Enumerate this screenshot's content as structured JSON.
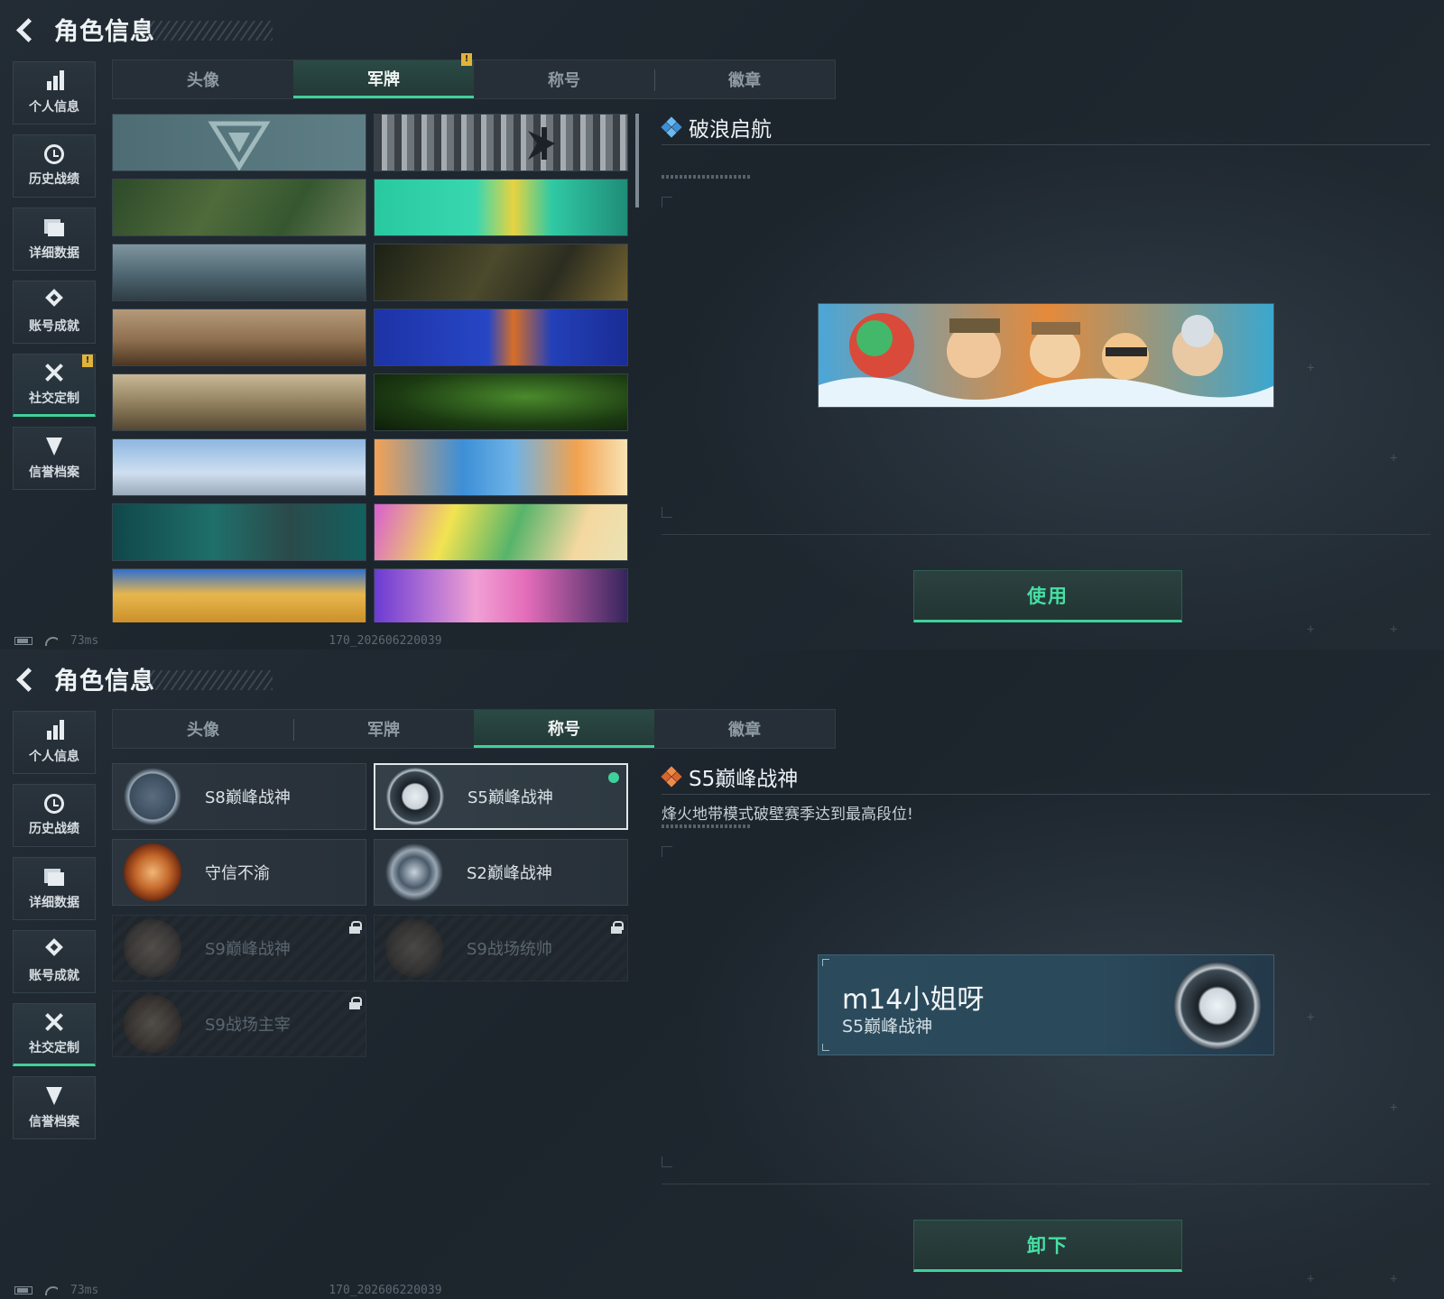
{
  "header": {
    "title": "角色信息"
  },
  "sidebar": {
    "items": [
      {
        "label": "个人信息",
        "icon": "bar-chart-icon"
      },
      {
        "label": "历史战绩",
        "icon": "clock-icon"
      },
      {
        "label": "详细数据",
        "icon": "folder-icon"
      },
      {
        "label": "账号成就",
        "icon": "medal-icon"
      },
      {
        "label": "社交定制",
        "icon": "tools-icon"
      },
      {
        "label": "信誉档案",
        "icon": "shield-icon"
      }
    ],
    "alert_mark": "!"
  },
  "tabs": [
    "头像",
    "军牌",
    "称号",
    "徽章"
  ],
  "colors": {
    "accent": "#3fd19a",
    "alert": "#e0b43a",
    "locked_text": "#5a6670"
  },
  "screen1": {
    "active_tab": "军牌",
    "tab_alert": "!",
    "selected_banner": {
      "title": "破浪启航"
    },
    "action_label": "使用",
    "banners": [
      "emblem-logo-banner",
      "chrome-logo-banner",
      "weapons-table-banner",
      "cartoon-teal-banner",
      "helicopter-sky-banner",
      "weapons-dark-banner",
      "aircraft-desert-banner",
      "blue-mask-banner",
      "sniper-ruins-banner",
      "night-vision-banner",
      "castle-sky-banner",
      "orange-fish-banner",
      "gym-teal-banner",
      "music-colorful-banner",
      "desert-sunset-banner",
      "pink-city-banner"
    ]
  },
  "screen2": {
    "active_tab": "称号",
    "selected_title": {
      "name": "S5巅峰战神",
      "description": "烽火地带模式破壁赛季达到最高段位!"
    },
    "titles": [
      {
        "name": "S8巅峰战神",
        "locked": false,
        "equipped": false
      },
      {
        "name": "S5巅峰战神",
        "locked": false,
        "equipped": true
      },
      {
        "name": "守信不渝",
        "locked": false,
        "equipped": false
      },
      {
        "name": "S2巅峰战神",
        "locked": false,
        "equipped": false
      },
      {
        "name": "S9巅峰战神",
        "locked": true,
        "equipped": false
      },
      {
        "name": "S9战场统帅",
        "locked": true,
        "equipped": false
      },
      {
        "name": "S9战场主宰",
        "locked": true,
        "equipped": false
      }
    ],
    "nameplate": {
      "player_name": "m14小姐呀",
      "title": "S5巅峰战神"
    },
    "action_label": "卸下"
  },
  "statusbar": {
    "ping": "73ms",
    "build": "170_202606220039"
  }
}
